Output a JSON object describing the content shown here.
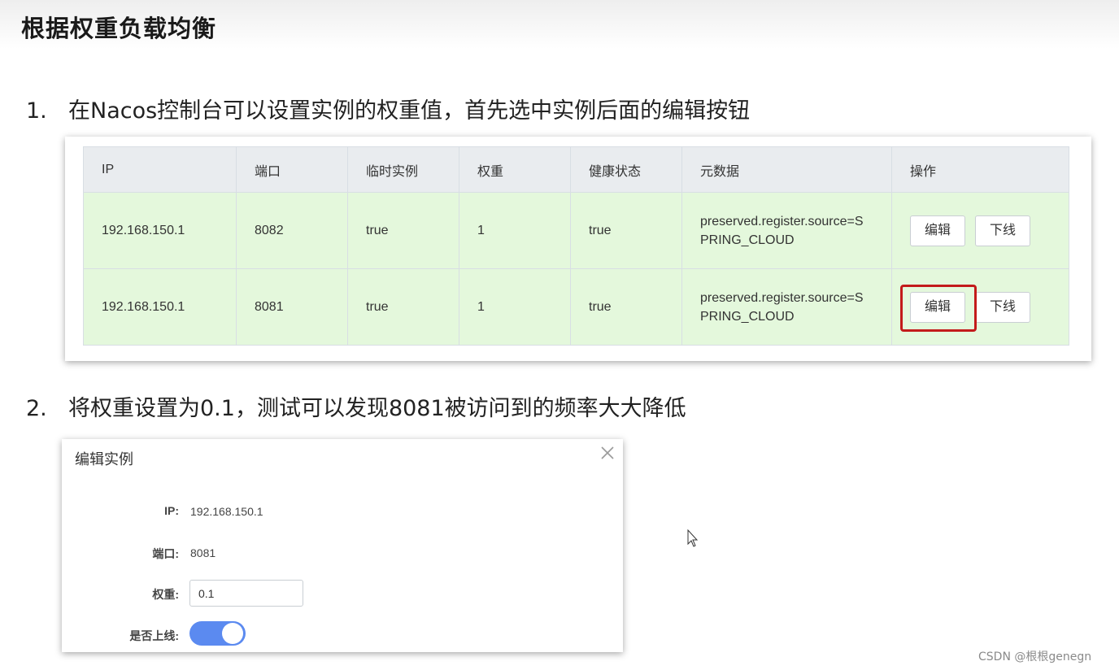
{
  "page_title": "根据权重负载均衡",
  "steps": [
    {
      "num": "1.",
      "text": "在Nacos控制台可以设置实例的权重值，首先选中实例后面的编辑按钮"
    },
    {
      "num": "2.",
      "text": "将权重设置为0.1，测试可以发现8081被访问到的频率大大降低"
    }
  ],
  "table": {
    "headers": [
      "IP",
      "端口",
      "临时实例",
      "权重",
      "健康状态",
      "元数据",
      "操作"
    ],
    "rows": [
      {
        "ip": "192.168.150.1",
        "port": "8082",
        "ephemeral": "true",
        "weight": "1",
        "healthy": "true",
        "metadata_line1": "preserved.register.source=S",
        "metadata_line2": "PRING_CLOUD",
        "edit_label": "编辑",
        "offline_label": "下线"
      },
      {
        "ip": "192.168.150.1",
        "port": "8081",
        "ephemeral": "true",
        "weight": "1",
        "healthy": "true",
        "metadata_line1": "preserved.register.source=S",
        "metadata_line2": "PRING_CLOUD",
        "edit_label": "编辑",
        "offline_label": "下线"
      }
    ]
  },
  "dialog": {
    "title": "编辑实例",
    "ip_label": "IP:",
    "ip_value": "192.168.150.1",
    "port_label": "端口:",
    "port_value": "8081",
    "weight_label": "权重:",
    "weight_value": "0.1",
    "online_label": "是否上线:",
    "online_enabled": true
  },
  "colors": {
    "row_bg": "#e4f8dc",
    "header_bg": "#e9ecef",
    "highlight": "#c31b1b",
    "toggle_on": "#5b8af0"
  },
  "icons": {
    "close": "close-icon",
    "cursor": "mouse-cursor-icon"
  },
  "watermark": "CSDN @根根genegn"
}
